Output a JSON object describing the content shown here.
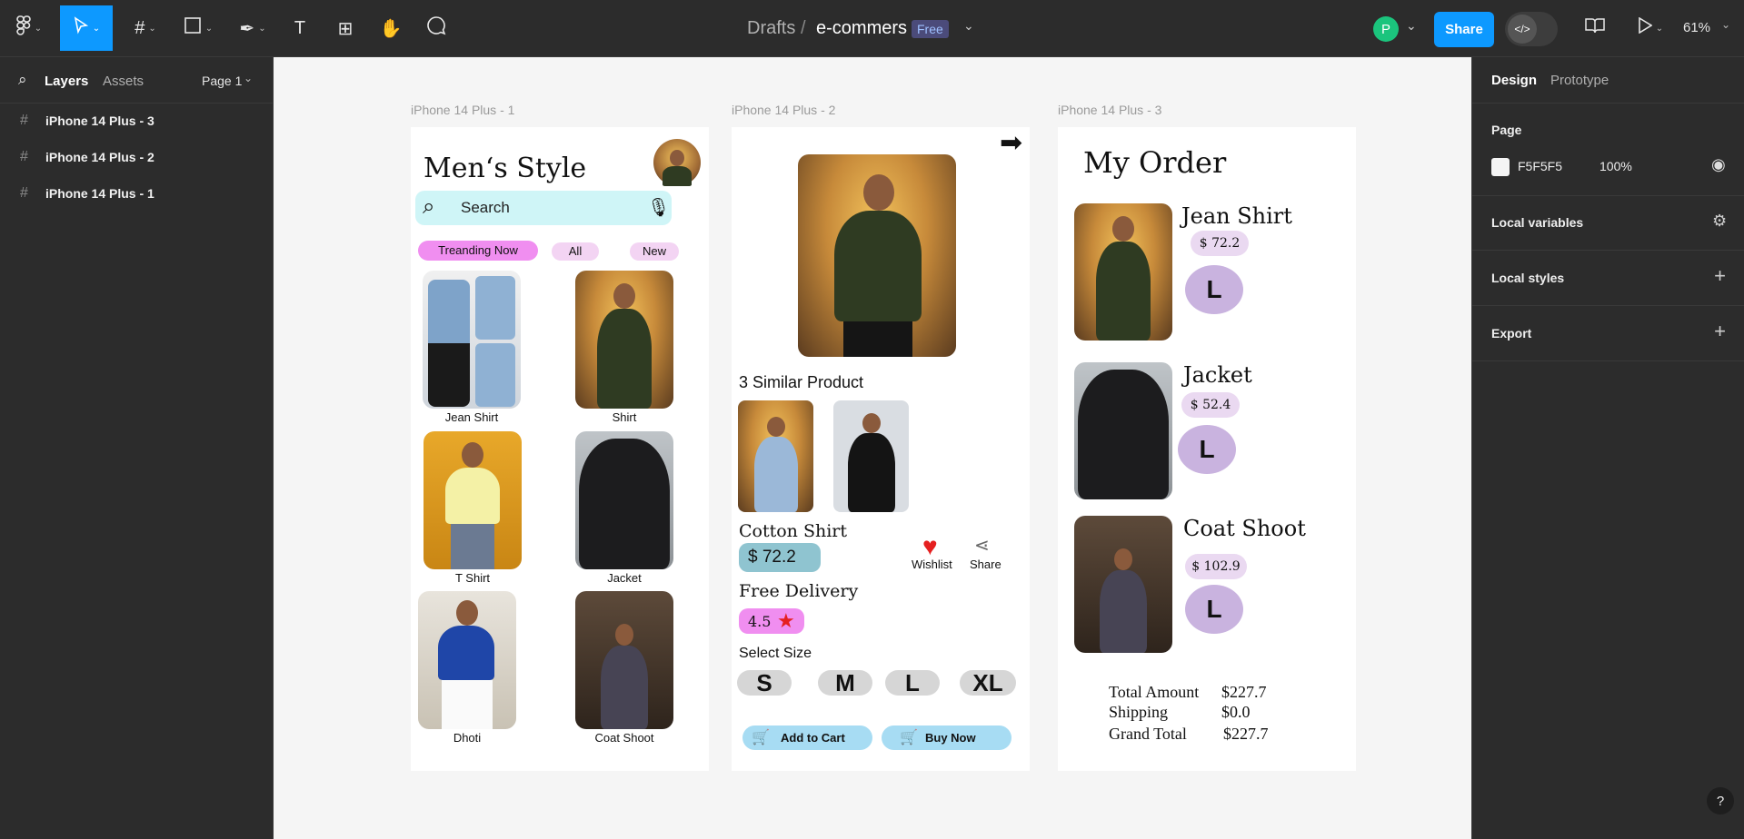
{
  "toolbar": {
    "breadcrumb_drafts": "Drafts",
    "breadcrumb_sep": "/",
    "file_name": "e-commers",
    "plan_badge": "Free",
    "avatar_initial": "P",
    "share_label": "Share",
    "zoom": "61%",
    "dev_mode_icon": "</>"
  },
  "left_panel": {
    "tab_layers": "Layers",
    "tab_assets": "Assets",
    "page_selector": "Page 1",
    "layers": [
      {
        "label": "iPhone 14 Plus - 3"
      },
      {
        "label": "iPhone 14 Plus - 2"
      },
      {
        "label": "iPhone 14 Plus - 1"
      }
    ]
  },
  "right_panel": {
    "tab_design": "Design",
    "tab_prototype": "Prototype",
    "page_heading": "Page",
    "page_color_hex": "F5F5F5",
    "page_opacity": "100%",
    "local_variables": "Local variables",
    "local_styles": "Local styles",
    "export": "Export",
    "help": "?"
  },
  "canvas": {
    "frame_labels": [
      "iPhone 14 Plus - 1",
      "iPhone 14 Plus - 2",
      "iPhone 14 Plus - 3"
    ],
    "frame1": {
      "title": "Men‘s Style",
      "search_placeholder": "Search",
      "chips": [
        "Treanding Now",
        "All",
        "New"
      ],
      "products": [
        "Jean Shirt",
        "Shirt",
        "T Shirt",
        "Jacket",
        "Dhoti",
        "Coat Shoot"
      ]
    },
    "frame2": {
      "similar_heading": "3 Similar Product",
      "product_name": "Cotton Shirt",
      "price": "$ 72.2",
      "wishlist": "Wishlist",
      "share": "Share",
      "delivery": "Free Delivery",
      "rating": "4.5",
      "select_size": "Select Size",
      "sizes": [
        "S",
        "M",
        "L",
        "XL"
      ],
      "add_to_cart": "Add to Cart",
      "buy_now": "Buy Now"
    },
    "frame3": {
      "title": "My Order",
      "items": [
        {
          "name": "Jean Shirt",
          "price": "$ 72.2",
          "size": "L"
        },
        {
          "name": "Jacket",
          "price": "$ 52.4",
          "size": "L"
        },
        {
          "name": "Coat Shoot",
          "price": "$ 102.9",
          "size": "L"
        }
      ],
      "total_amount_label": "Total Amount",
      "total_amount": "$227.7",
      "shipping_label": "Shipping",
      "shipping": "$0.0",
      "grand_total_label": "Grand Total",
      "grand_total": "$227.7"
    }
  },
  "colors": {
    "accent_blue": "#0d99ff",
    "chip_pink": "#f08ef0",
    "search_bg": "#cff5f7",
    "size_bubble": "#c9b3df",
    "button_blue": "#a7dcf3"
  }
}
